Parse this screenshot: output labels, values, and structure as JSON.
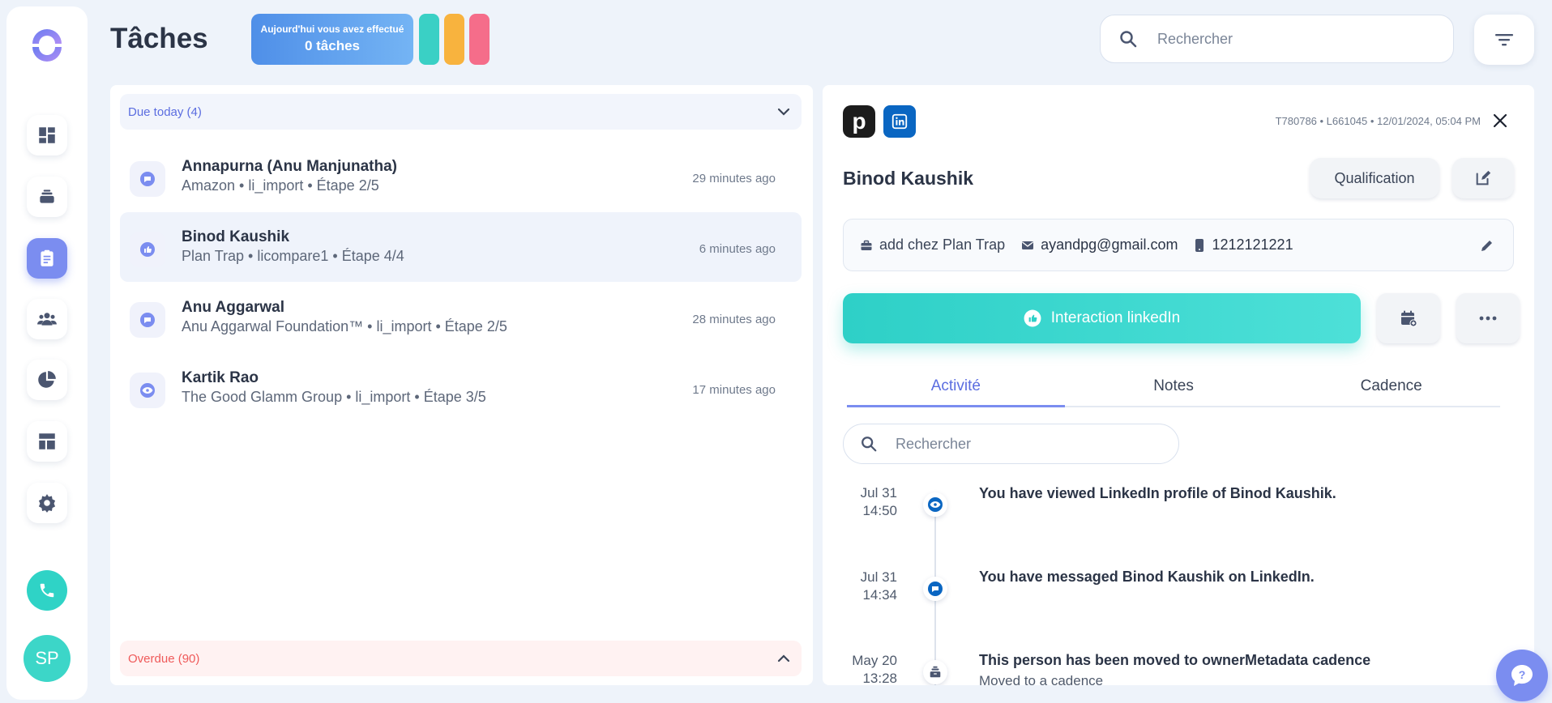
{
  "header": {
    "title": "Tâches",
    "stats": {
      "line1": "Aujourd'hui vous avez effectué",
      "line2": "0 tâches"
    },
    "pill_colors": [
      "#3ad0c5",
      "#f8b33e",
      "#f56d8a"
    ],
    "search_placeholder": "Rechercher"
  },
  "sidebar": {
    "items": [
      {
        "icon": "dashboard-icon"
      },
      {
        "icon": "layers-icon"
      },
      {
        "icon": "clipboard-icon",
        "active": true
      },
      {
        "icon": "people-icon"
      },
      {
        "icon": "pie-chart-icon"
      },
      {
        "icon": "layout-icon"
      },
      {
        "icon": "gear-icon"
      }
    ],
    "avatar_initials": "SP"
  },
  "tasks": {
    "due_label": "Due today (4)",
    "overdue_label": "Overdue (90)",
    "items": [
      {
        "name": "Annapurna (Anu Manjunatha)",
        "sub": "Amazon • li_import • Étape 2/5",
        "time": "29 minutes ago",
        "icon": "message-icon"
      },
      {
        "name": "Binod Kaushik",
        "sub": "Plan Trap • licompare1 • Étape 4/4",
        "time": "6 minutes ago",
        "icon": "thumbs-up-icon"
      },
      {
        "name": "Anu Aggarwal",
        "sub": "Anu Aggarwal Foundation™ • li_import • Étape 2/5",
        "time": "28 minutes ago",
        "icon": "message-icon"
      },
      {
        "name": "Kartik Rao",
        "sub": "The Good Glamm Group • li_import • Étape 3/5",
        "time": "17 minutes ago",
        "icon": "eye-icon"
      }
    ]
  },
  "detail": {
    "meta": "T780786 • L661045 • 12/01/2024, 05:04 PM",
    "name": "Binod Kaushik",
    "qualification_label": "Qualification",
    "info": {
      "job": "add chez Plan Trap",
      "email": "ayandpg@gmail.com",
      "phone": "1212121221"
    },
    "cta_label": "Interaction linkedIn",
    "tabs": [
      "Activité",
      "Notes",
      "Cadence"
    ],
    "search_placeholder": "Rechercher",
    "activities": [
      {
        "date": "Jul 31",
        "time": "14:50",
        "title": "You have viewed LinkedIn profile of Binod Kaushik.",
        "sub": "",
        "icon": "eye-icon"
      },
      {
        "date": "Jul 31",
        "time": "14:34",
        "title": "You have messaged Binod Kaushik on LinkedIn.",
        "sub": "",
        "icon": "message-icon"
      },
      {
        "date": "May 20",
        "time": "13:28",
        "title": "This person has been moved to ownerMetadata cadence",
        "sub": "Moved to a cadence",
        "icon": "inbox-icon"
      }
    ]
  },
  "colors": {
    "accent": "#7b8df0",
    "teal": "#2ed0c7",
    "linkedin": "#0a66c2",
    "overdue": "#ef5a5a"
  }
}
